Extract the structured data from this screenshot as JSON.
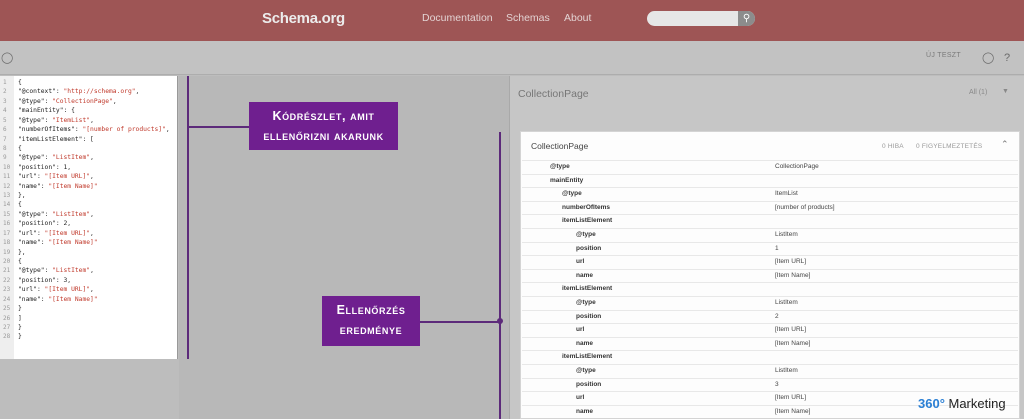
{
  "header": {
    "logo": "Schema.org",
    "nav": [
      "Documentation",
      "Schemas",
      "About"
    ],
    "search_icon": "search-icon"
  },
  "toolbar": {
    "new_test": "ÚJ TESZT",
    "left_icon": "globe-icon",
    "globe_icon": "globe-icon",
    "help_icon": "help-icon"
  },
  "code": {
    "lines": [
      "{",
      "\"@context\": \"http://schema.org\",",
      "\"@type\": \"CollectionPage\",",
      "\"mainEntity\": {",
      "\"@type\": \"ItemList\",",
      "\"numberOfItems\": \"[number of products]\",",
      "\"itemListElement\": [",
      "{",
      "\"@type\": \"ListItem\",",
      "\"position\": 1,",
      "\"url\": \"[Item URL]\",",
      "\"name\": \"[Item Name]\"",
      "},",
      "{",
      "\"@type\": \"ListItem\",",
      "\"position\": 2,",
      "\"url\": \"[Item URL]\",",
      "\"name\": \"[Item Name]\"",
      "},",
      "{",
      "\"@type\": \"ListItem\",",
      "\"position\": 3,",
      "\"url\": \"[Item URL]\",",
      "\"name\": \"[Item Name]\"",
      "}",
      "]",
      "}",
      "}"
    ]
  },
  "results": {
    "title": "CollectionPage",
    "filter": "All (1)",
    "caret_icon": "caret-down-icon",
    "card_title": "CollectionPage",
    "errors": "0 HIBA",
    "warnings": "0 FIGYELMEZTETÉS",
    "collapse_icon": "chevron-up-icon",
    "rows": [
      {
        "key": "@type",
        "value": "CollectionPage",
        "level": 0
      },
      {
        "key": "mainEntity",
        "value": "",
        "level": 0
      },
      {
        "key": "@type",
        "value": "ItemList",
        "level": 1
      },
      {
        "key": "numberOfItems",
        "value": "[number of products]",
        "level": 1
      },
      {
        "key": "itemListElement",
        "value": "",
        "level": 1
      },
      {
        "key": "@type",
        "value": "ListItem",
        "level": 2
      },
      {
        "key": "position",
        "value": "1",
        "level": 2
      },
      {
        "key": "url",
        "value": "[Item URL]",
        "level": 2
      },
      {
        "key": "name",
        "value": "[Item Name]",
        "level": 2
      },
      {
        "key": "itemListElement",
        "value": "",
        "level": 1
      },
      {
        "key": "@type",
        "value": "ListItem",
        "level": 2
      },
      {
        "key": "position",
        "value": "2",
        "level": 2
      },
      {
        "key": "url",
        "value": "[Item URL]",
        "level": 2
      },
      {
        "key": "name",
        "value": "[Item Name]",
        "level": 2
      },
      {
        "key": "itemListElement",
        "value": "",
        "level": 1
      },
      {
        "key": "@type",
        "value": "ListItem",
        "level": 2
      },
      {
        "key": "position",
        "value": "3",
        "level": 2
      },
      {
        "key": "url",
        "value": "[Item URL]",
        "level": 2
      },
      {
        "key": "name",
        "value": "[Item Name]",
        "level": 2
      }
    ]
  },
  "annotations": {
    "code_callout": [
      "Kódrészlet, amit",
      "ellenőrizni akarunk"
    ],
    "result_callout": [
      "Ellenőrzés",
      "eredménye"
    ],
    "accent_color": "#6f1f8f"
  },
  "brand": {
    "number": "360°",
    "name": " Marketing"
  }
}
